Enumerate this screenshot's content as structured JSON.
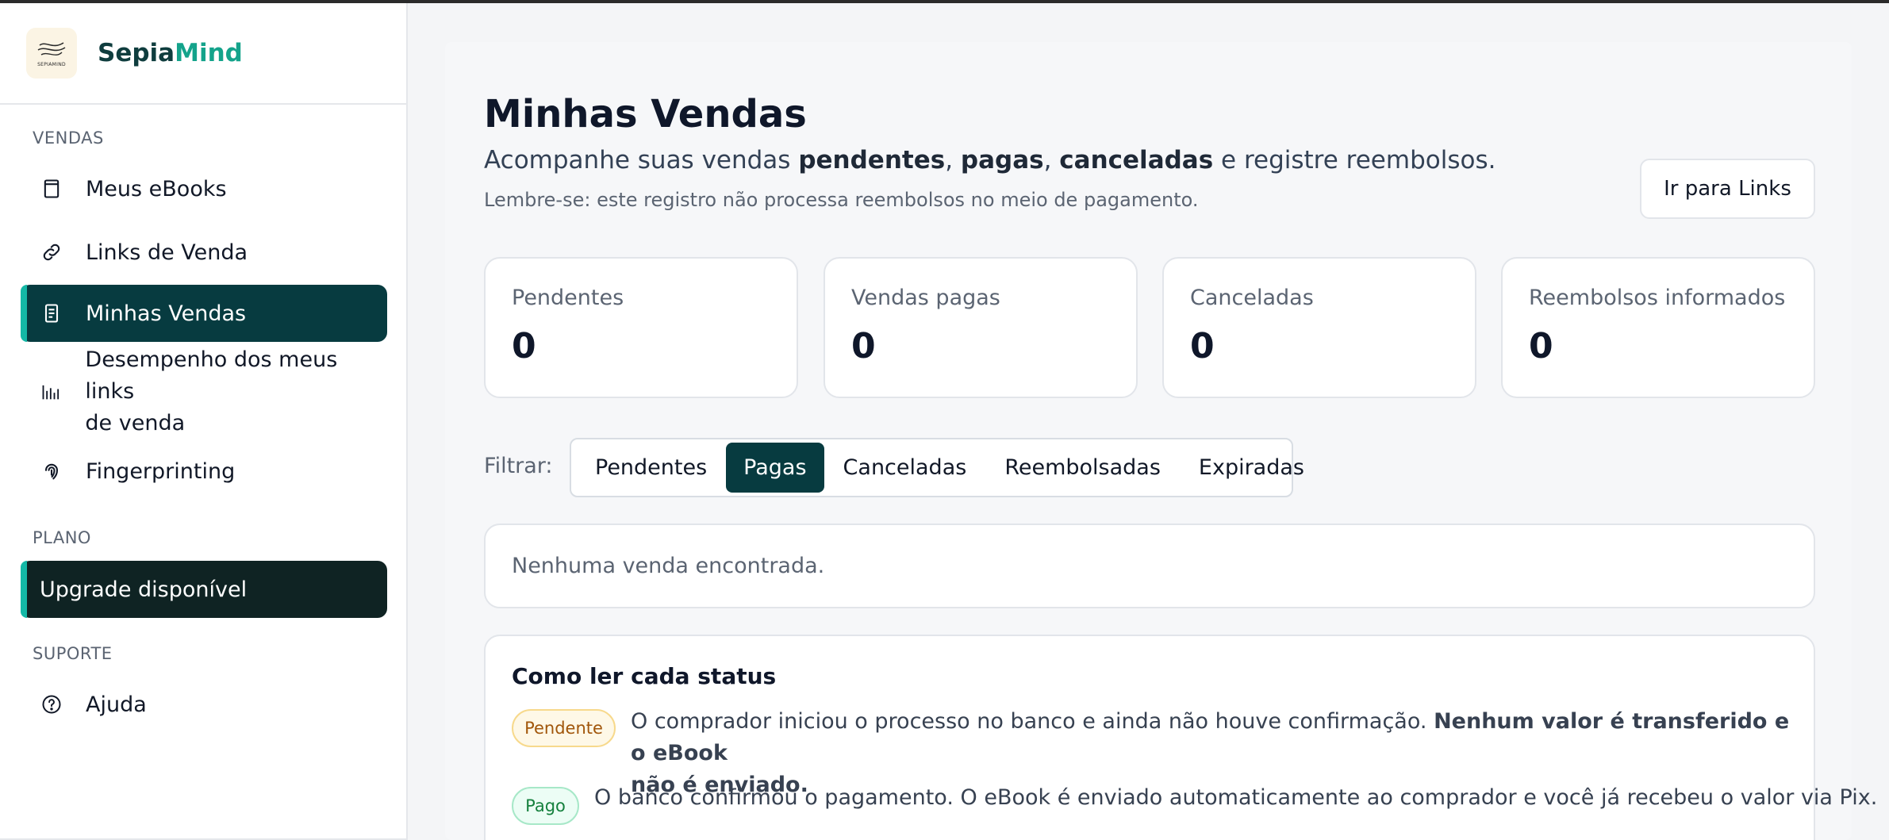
{
  "brand": {
    "name_part1": "Sepia",
    "name_part2": "Mind",
    "logo_text": "SEPIAMIND"
  },
  "sidebar": {
    "sections": {
      "sales": "VENDAS",
      "plan": "PLANO",
      "support": "SUPORTE"
    },
    "items": [
      {
        "label": "Meus eBooks",
        "icon": "book-icon"
      },
      {
        "label": "Links de Venda",
        "icon": "link-icon"
      },
      {
        "label": "Minhas Vendas",
        "icon": "receipt-icon",
        "active": true
      },
      {
        "label_line1": "Desempenho dos meus links",
        "label_line2": "de venda",
        "icon": "bar-chart-icon"
      },
      {
        "label": "Fingerprinting",
        "icon": "fingerprint-icon"
      }
    ],
    "upgrade_label": "Upgrade disponível",
    "help_label": "Ajuda"
  },
  "page": {
    "title": "Minhas Vendas",
    "subtitle": {
      "part1": "Acompanhe suas vendas ",
      "pendentes": "pendentes",
      "sep1": ", ",
      "pagas": "pagas",
      "sep2": ", ",
      "canceladas": "canceladas",
      "part2": " e registre reembolsos."
    },
    "note": "Lembre-se: este registro não processa reembolsos no meio de pagamento.",
    "links_button": "Ir para Links"
  },
  "stats": [
    {
      "label": "Pendentes",
      "value": "0"
    },
    {
      "label": "Vendas pagas",
      "value": "0"
    },
    {
      "label": "Canceladas",
      "value": "0"
    },
    {
      "label": "Reembolsos informados",
      "value": "0"
    }
  ],
  "filter": {
    "label": "Filtrar:",
    "options": [
      "Pendentes",
      "Pagas",
      "Canceladas",
      "Reembolsadas",
      "Expiradas"
    ],
    "selected": "Pagas"
  },
  "empty_message": "Nenhuma venda encontrada.",
  "status_help": {
    "title": "Como ler cada status",
    "items": [
      {
        "badge": "Pendente",
        "text": "O comprador iniciou o processo no banco e ainda não houve confirmação. ",
        "bold_line1": "Nenhum valor é transferido e o eBook",
        "bold_line2": "não é enviado."
      },
      {
        "badge": "Pago",
        "text": "O banco confirmou o pagamento. O eBook é enviado automaticamente ao comprador e você já recebeu o valor via Pix."
      }
    ]
  },
  "colors": {
    "primary": "#073b40",
    "accent": "#14b8a6",
    "brand_teal": "#14a38b"
  }
}
